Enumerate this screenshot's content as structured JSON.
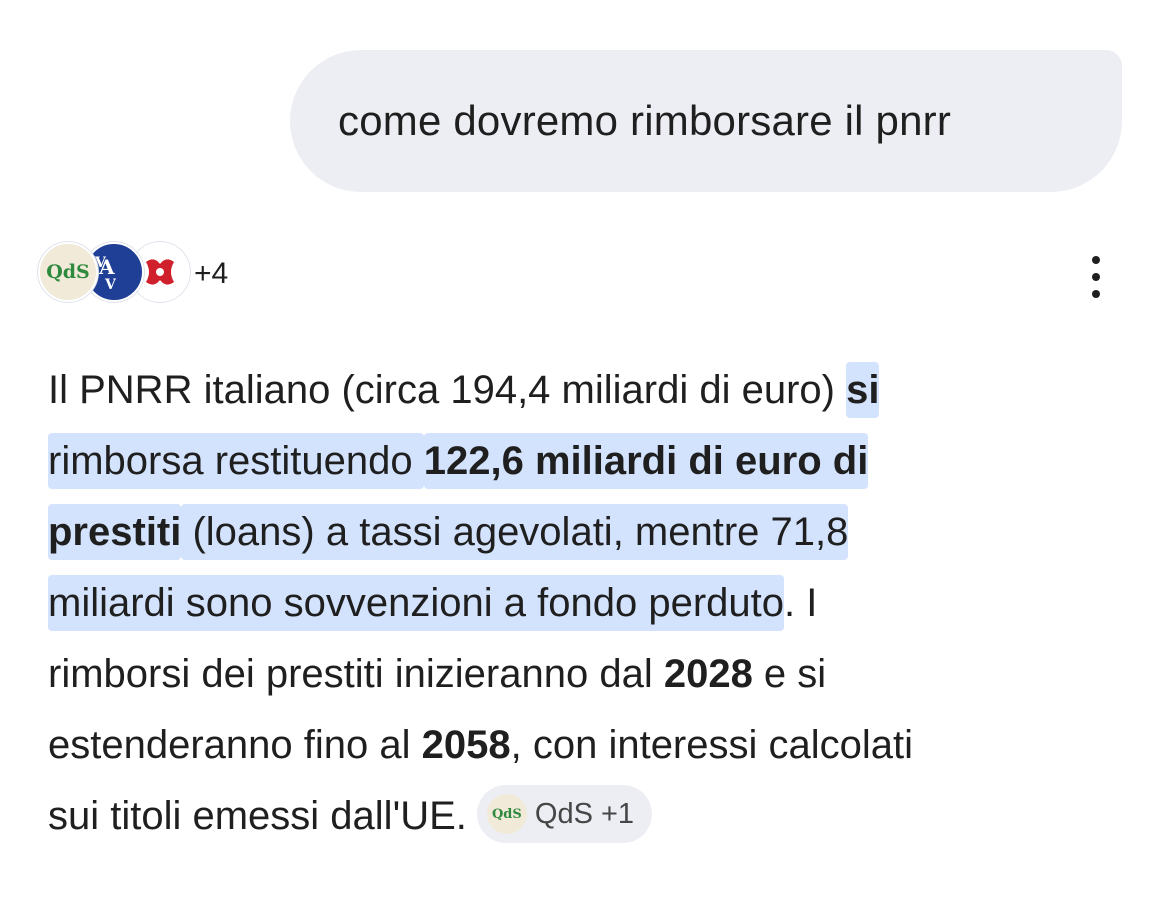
{
  "query": {
    "text": "come dovremo rimborsare il pnrr"
  },
  "sources": {
    "logos": [
      {
        "name": "QdS",
        "label": "QdS",
        "color": "#2e8a3e",
        "bg": "#f2ead8"
      },
      {
        "name": "AVV",
        "label": "AVV",
        "color": "#ffffff",
        "bg": "#1e3f95"
      },
      {
        "name": "red-logo",
        "label": "",
        "color": "#d0202c",
        "bg": "#ffffff"
      }
    ],
    "more_count": "+4"
  },
  "answer": {
    "lines": [
      {
        "parts": [
          {
            "t": "Il PNRR italiano (circa 194,4 miliardi di euro) "
          },
          {
            "t": "si",
            "b": true,
            "h": true
          }
        ]
      },
      {
        "parts": [
          {
            "t": "rimborsa restituendo ",
            "h": true
          },
          {
            "t": "122,6 miliardi di euro di",
            "b": true,
            "h": true
          }
        ]
      },
      {
        "parts": [
          {
            "t": "prestiti",
            "b": true,
            "h": true
          },
          {
            "t": " (loans) a tassi agevolati, mentre 71,8",
            "h": true
          }
        ]
      },
      {
        "parts": [
          {
            "t": "miliardi sono sovvenzioni a fondo perduto",
            "h": true
          },
          {
            "t": ". I"
          }
        ]
      },
      {
        "parts": [
          {
            "t": "rimborsi dei prestiti inizieranno dal "
          },
          {
            "t": "2028",
            "b": true
          },
          {
            "t": " e si"
          }
        ]
      },
      {
        "parts": [
          {
            "t": "estenderanno fino al "
          },
          {
            "t": "2058",
            "b": true
          },
          {
            "t": ", con interessi calcolati"
          }
        ]
      },
      {
        "parts": [
          {
            "t": "sui titoli emessi dall'UE."
          }
        ]
      }
    ],
    "citation": {
      "logo_text": "QdS",
      "label": "QdS +1"
    }
  },
  "colors": {
    "highlight": "#d3e3fd",
    "bubble": "#edeef3",
    "text": "#1f1f1f"
  }
}
